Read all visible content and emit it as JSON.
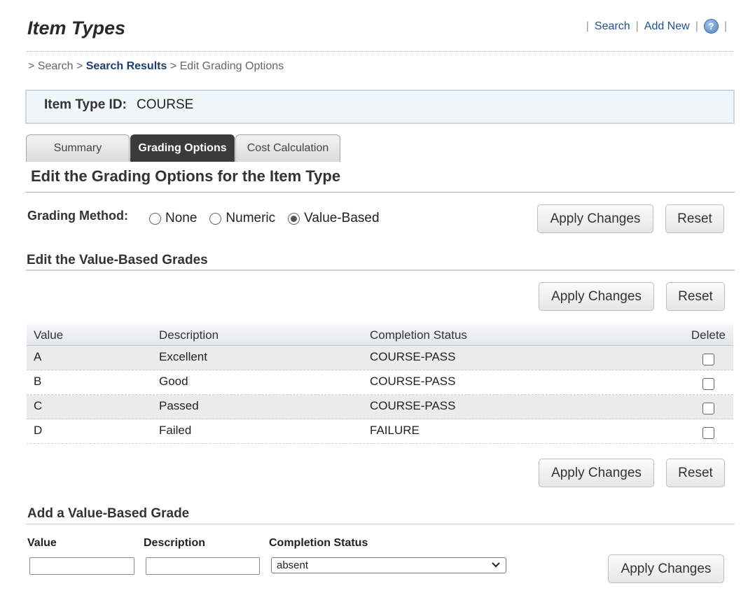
{
  "header": {
    "title": "Item Types",
    "links": {
      "search": "Search",
      "add_new": "Add New",
      "help_glyph": "?",
      "separator": "|"
    }
  },
  "breadcrumb": {
    "prefix": ">",
    "items": [
      "Search",
      "Search Results",
      "Edit Grading Options"
    ]
  },
  "item": {
    "id_label": "Item Type ID:",
    "id_value": "COURSE"
  },
  "tabs": [
    {
      "label": "Summary",
      "active": false
    },
    {
      "label": "Grading Options",
      "active": true
    },
    {
      "label": "Cost Calculation",
      "active": false
    }
  ],
  "section_title": "Edit the Grading Options for the Item Type",
  "grading_method": {
    "label": "Grading Method:",
    "options": [
      "None",
      "Numeric",
      "Value-Based"
    ],
    "selected": "Value-Based"
  },
  "buttons": {
    "apply": "Apply Changes",
    "reset": "Reset"
  },
  "value_grades": {
    "title": "Edit the Value-Based Grades",
    "columns": [
      "Value",
      "Description",
      "Completion Status",
      "Delete"
    ],
    "rows": [
      {
        "value": "A",
        "description": "Excellent",
        "status": "COURSE-PASS",
        "delete": false
      },
      {
        "value": "B",
        "description": "Good",
        "status": "COURSE-PASS",
        "delete": false
      },
      {
        "value": "C",
        "description": "Passed",
        "status": "COURSE-PASS",
        "delete": false
      },
      {
        "value": "D",
        "description": "Failed",
        "status": "FAILURE",
        "delete": false
      }
    ]
  },
  "add_grade": {
    "title": "Add a Value-Based Grade",
    "value_label": "Value",
    "description_label": "Description",
    "status_label": "Completion Status",
    "value_input": "",
    "description_input": "",
    "status_selected": "absent"
  },
  "colors": {
    "link": "#1f4e99",
    "active_tab": "#3b3b3b",
    "id_box_bg": "#f1f6fb"
  }
}
